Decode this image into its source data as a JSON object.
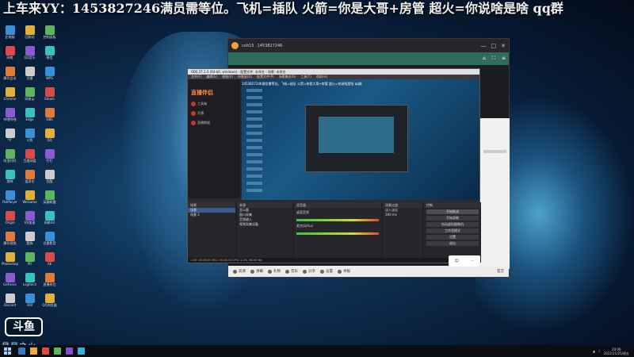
{
  "ticker_text": "上车来YY：1453827246满员需等位。飞机=插队 火箭=你是大哥+房管 超火=你说啥是啥 qq群",
  "desktop_icons": [
    "此电脑",
    "回收站",
    "控制面板",
    "网络",
    "QQ音乐",
    "微信",
    "腾讯会议",
    "迅雷",
    "WPS",
    "Chrome",
    "网易云",
    "Steam",
    "哔哩哔哩",
    "Edge",
    "OBS",
    "YY",
    "斗鱼",
    "QQ",
    "阿里旺旺",
    "百度网盘",
    "钉钉",
    "剪映",
    "爱奇艺",
    "优酷",
    "PotPlayer",
    "WeGame",
    "英雄联盟",
    "Origin",
    "UU加速",
    "网易UU",
    "腾讯视频",
    "酷狗",
    "迅雷影音",
    "Photoshop",
    "PR",
    "AE",
    "GeForce",
    "Logitech",
    "直播伴侣",
    "Discord",
    "360",
    "QQ浏览器"
  ],
  "douyu_logo": "斗鱼",
  "signature": "星星之火",
  "player": {
    "room": "coit15",
    "id": "1453827246",
    "close": "✕",
    "min": "—",
    "max": "□",
    "bottom_items": [
      "高清",
      "弹幕",
      "礼物",
      "音乐",
      "分享",
      "设置",
      "举报"
    ],
    "right_label": "官方"
  },
  "obs": {
    "title": "OBS 27.1.3 (64-bit, windows) - 配置文件: 未命名 - 场景: 未命名",
    "menu": [
      "文件(F)",
      "编辑(E)",
      "视图(V)",
      "停靠窗(D)",
      "配置文件(P)",
      "场景集合(S)",
      "工具(T)",
      "帮助(H)"
    ],
    "brand": "直播伴侣",
    "side_items": [
      "工具箱",
      "开播",
      "直播数据"
    ],
    "preview_ticker": "1453827246满员需等位。飞机=插队 火箭=你是大哥+房管 超火=你说啥是啥 qq群",
    "scenes_header": "场景",
    "scenes": [
      "场景",
      "场景 2"
    ],
    "sources_header": "来源",
    "sources": [
      "显示器",
      "窗口采集",
      "音频输入",
      "视频采集设备"
    ],
    "mixer_header": "混音器",
    "mixer": [
      "桌面音频",
      "麦克风/Aux"
    ],
    "transition_header": "场景过渡",
    "transition": [
      "淡入淡出",
      "300 ms"
    ],
    "controls_header": "控制",
    "controls": [
      "开始推流",
      "开始录制",
      "启动虚拟摄像机",
      "工作室模式",
      "设置",
      "退出"
    ],
    "status": "LIVE: 00:00:00  REC: 00:00:00  CPU: 2.3%, 60.00 fps"
  },
  "taskbar": {
    "time": "20:06",
    "date": "2022/11/25/周五"
  },
  "colors": {
    "obs_accent": "#ff8a3d",
    "player_sub": "#2f6b5e"
  }
}
